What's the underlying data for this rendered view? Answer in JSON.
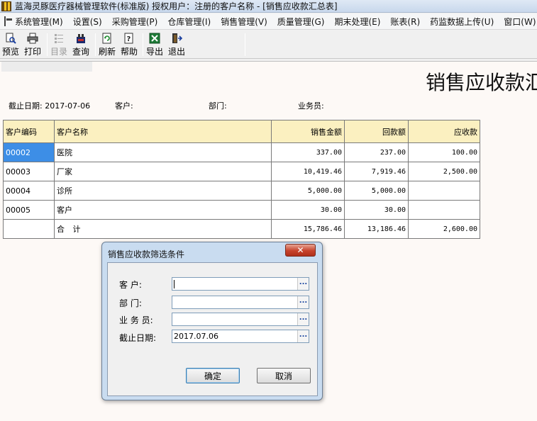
{
  "window": {
    "title": "蓝海灵豚医疗器械管理软件(标准版)    授权用户：注册的客户名称 - [销售应收款汇总表]"
  },
  "menu": {
    "items": [
      "系统管理(M)",
      "设置(S)",
      "采购管理(P)",
      "仓库管理(I)",
      "销售管理(V)",
      "质量管理(G)",
      "期末处理(E)",
      "账表(R)",
      "药监数据上传(U)",
      "窗口(W)"
    ]
  },
  "toolbar": {
    "buttons": [
      {
        "label": "预览",
        "icon": "preview-icon",
        "enabled": true
      },
      {
        "label": "打印",
        "icon": "printer-icon",
        "enabled": true
      },
      {
        "label": "目录",
        "icon": "catalog-icon",
        "enabled": false
      },
      {
        "label": "查询",
        "icon": "query-icon",
        "enabled": true
      },
      {
        "label": "刷新",
        "icon": "refresh-icon",
        "enabled": true
      },
      {
        "label": "帮助",
        "icon": "help-icon",
        "enabled": true
      },
      {
        "label": "导出",
        "icon": "excel-export-icon",
        "enabled": true
      },
      {
        "label": "退出",
        "icon": "exit-door-icon",
        "enabled": true
      }
    ]
  },
  "report": {
    "title": "销售应收款汇",
    "filters": {
      "date_label": "截止日期:",
      "date_value": "2017-07-06",
      "customer_label": "客户:",
      "department_label": "部门:",
      "salesperson_label": "业务员:"
    },
    "columns": [
      "客户编码",
      "客户名称",
      "销售金额",
      "回款额",
      "应收款"
    ],
    "rows": [
      {
        "code": "00002",
        "name": "医院",
        "sales": "337.00",
        "received": "237.00",
        "receivable": "100.00"
      },
      {
        "code": "00003",
        "name": "厂家",
        "sales": "10,419.46",
        "received": "7,919.46",
        "receivable": "2,500.00"
      },
      {
        "code": "00004",
        "name": "诊所",
        "sales": "5,000.00",
        "received": "5,000.00",
        "receivable": ""
      },
      {
        "code": "00005",
        "name": "客户",
        "sales": "30.00",
        "received": "30.00",
        "receivable": ""
      }
    ],
    "total": {
      "label": "合 计",
      "sales": "15,786.46",
      "received": "13,186.46",
      "receivable": "2,600.00"
    }
  },
  "dialog": {
    "title": "销售应收款筛选条件",
    "close_glyph": "✕",
    "fields": {
      "customer_label": "客    户:",
      "customer_value": "",
      "department_label": "部    门:",
      "department_value": "",
      "salesperson_label": "业 务 员:",
      "salesperson_value": "",
      "date_label": "截止日期:",
      "date_value": "2017.07.06"
    },
    "ellipsis": "...",
    "ok_label": "确定",
    "cancel_label": "取消"
  },
  "colors": {
    "header_bg": "#fbf0c0",
    "selected_cell": "#3d8ee6",
    "dialog_frame": "#c9dcf0",
    "close_button": "#c7432c"
  }
}
